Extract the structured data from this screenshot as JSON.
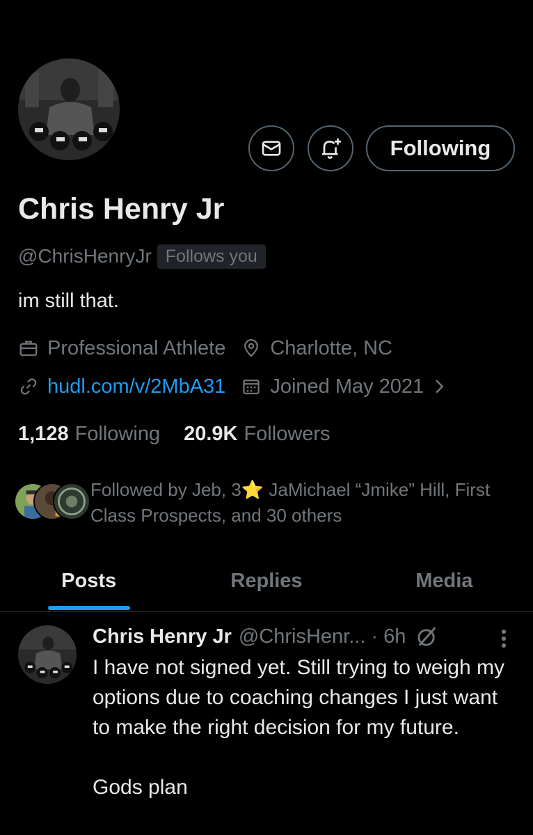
{
  "profile": {
    "name": "Chris Henry Jr",
    "handle": "@ChrisHenryJr",
    "follows_you": "Follows you",
    "bio": "im still that.",
    "profession": "Professional Athlete",
    "location": "Charlotte, NC",
    "website": "hudl.com/v/2MbA31",
    "joined": "Joined May 2021"
  },
  "actions": {
    "message_icon": "mail-icon",
    "notify_icon": "bell-plus-icon",
    "follow_label": "Following"
  },
  "stats": {
    "following_count": "1,128",
    "following_label": "Following",
    "followers_count": "20.9K",
    "followers_label": "Followers"
  },
  "followed_by": {
    "text": "Followed by Jeb, 3⭐ JaMichael “Jmike” Hill, First Class Prospects, and 30 others"
  },
  "tabs": [
    {
      "label": "Posts",
      "active": true
    },
    {
      "label": "Replies",
      "active": false
    },
    {
      "label": "Media",
      "active": false
    }
  ],
  "post": {
    "author": "Chris Henry Jr",
    "handle": "@ChrisHenr...",
    "time": "· 6h",
    "text": "I have not signed yet. Still trying to weigh my options due to coaching changes I just want to make the right decision for my future.\n\nGods plan"
  },
  "colors": {
    "background": "#000000",
    "text_primary": "#e7e9ea",
    "text_secondary": "#71767b",
    "accent": "#1d9bf0",
    "border": "#536471"
  }
}
